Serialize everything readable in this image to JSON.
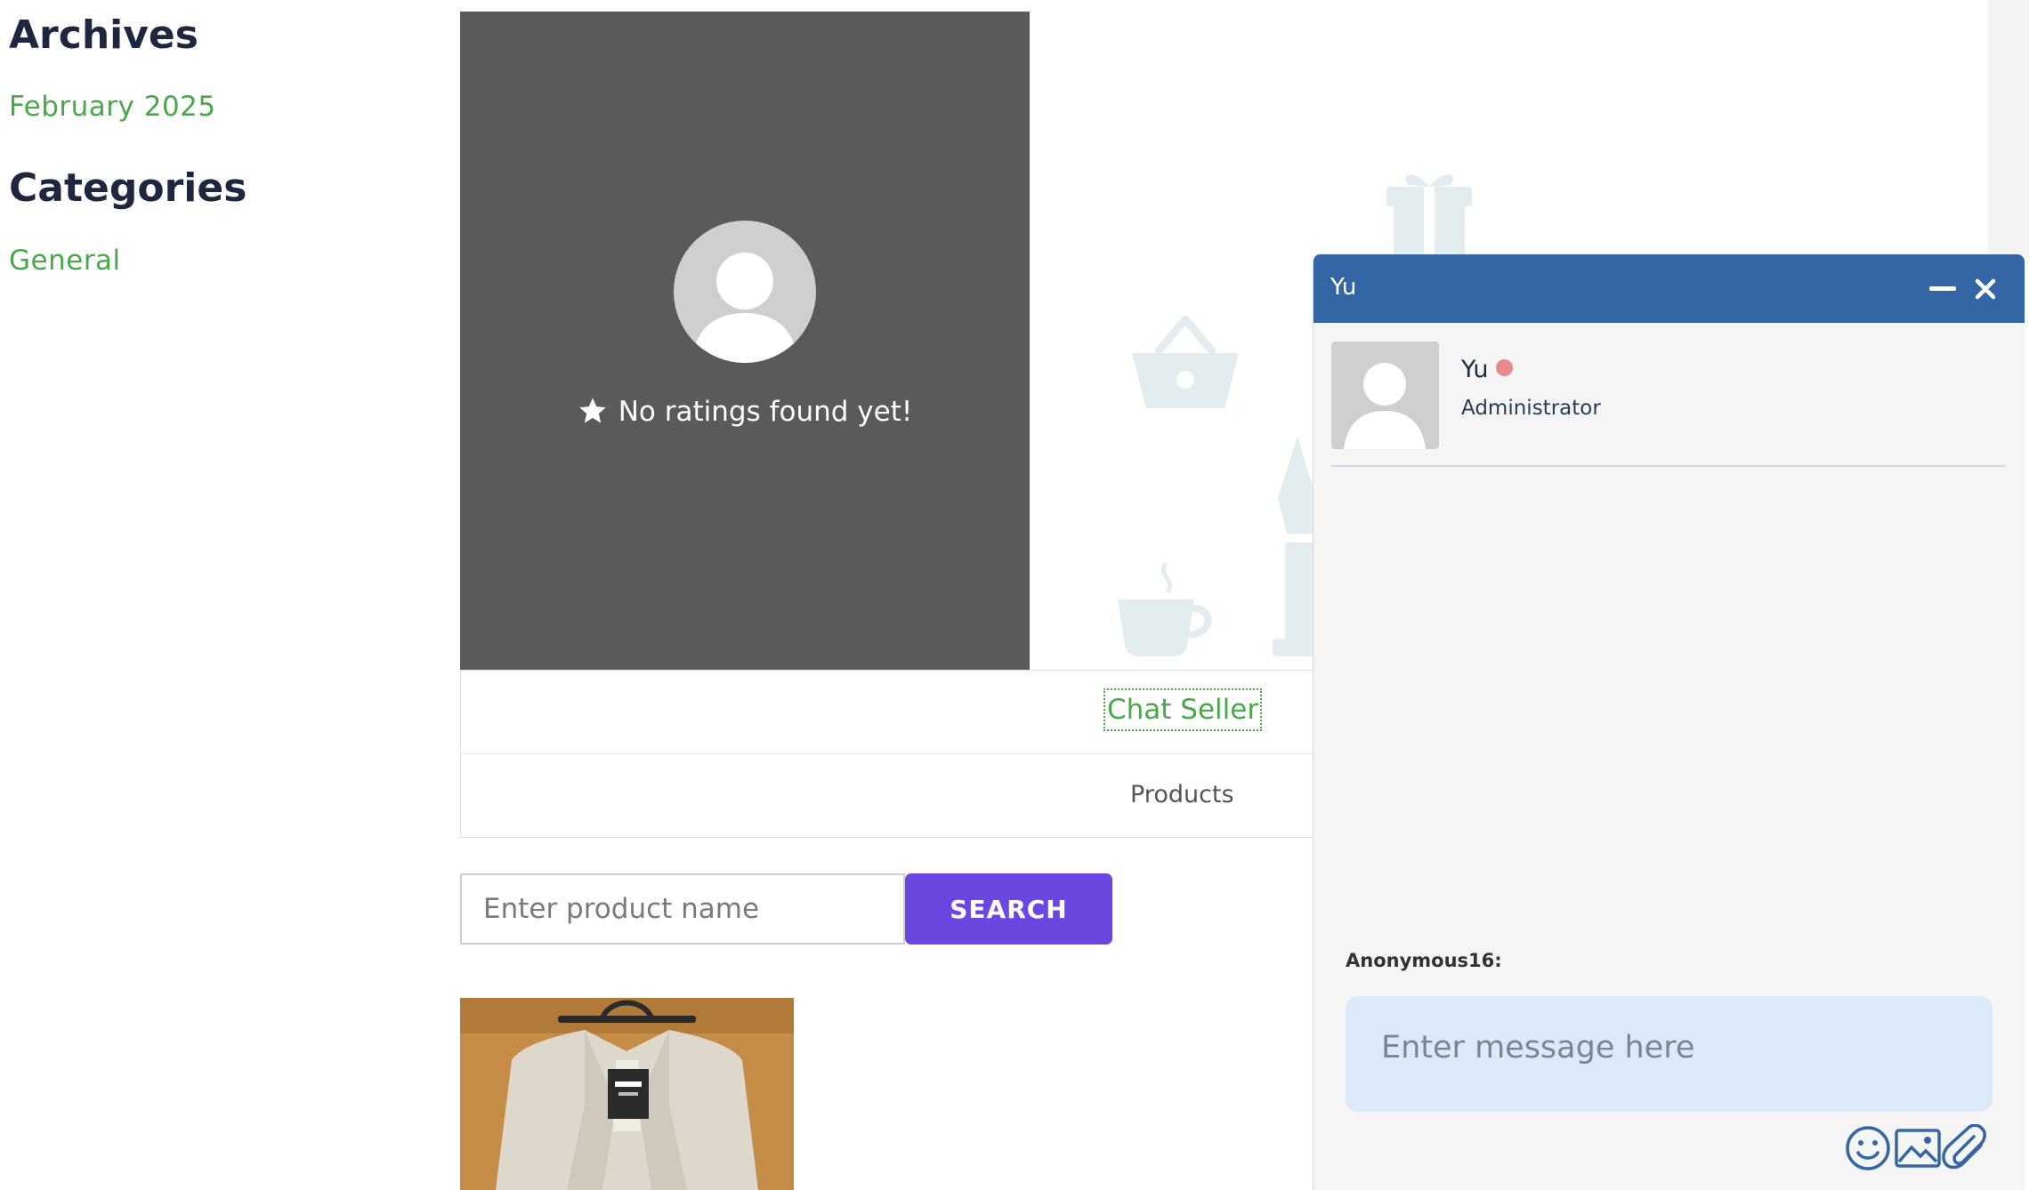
{
  "sidebar": {
    "archives_title": "Archives",
    "archive_link": "February 2025",
    "categories_title": "Categories",
    "category_link": "General"
  },
  "vendor": {
    "rating_text": "No ratings found yet!",
    "chat_seller": "Chat Seller",
    "products_tab": "Products"
  },
  "search": {
    "placeholder": "Enter product name",
    "button_label": "SEARCH"
  },
  "chat": {
    "header_title": "Yu",
    "agent_name": "Yu",
    "agent_role": "Administrator",
    "sender_label": "Anonymous16:",
    "message_placeholder": "Enter message here",
    "icons": [
      "emoji-icon",
      "image-icon",
      "attachment-icon"
    ]
  },
  "colors": {
    "link_green": "#49a84a",
    "chat_header_blue": "#3466a5",
    "search_button_purple": "#6b46e0",
    "vendor_card_gray": "#5a5a5a",
    "message_input_bg": "#dbe9f8"
  }
}
